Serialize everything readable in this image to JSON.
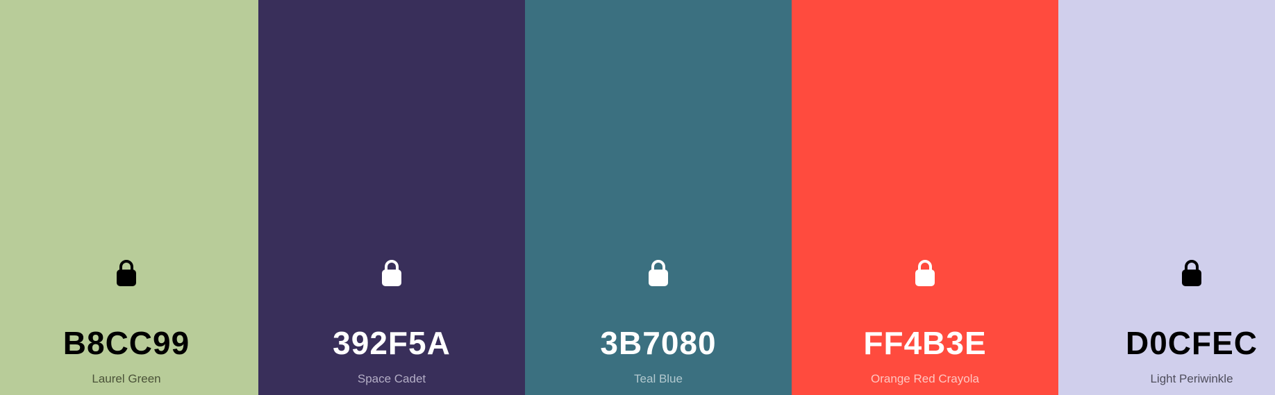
{
  "palette": {
    "swatches": [
      {
        "hex": "B8CC99",
        "name": "Laurel Green",
        "background": "#B8CC99",
        "text_color": "#000000",
        "name_color": "#4a5238",
        "lock_color": "#000000",
        "icon": "lock-icon"
      },
      {
        "hex": "392F5A",
        "name": "Space Cadet",
        "background": "#392F5A",
        "text_color": "#ffffff",
        "name_color": "#b4aec6",
        "lock_color": "#ffffff",
        "icon": "lock-icon"
      },
      {
        "hex": "3B7080",
        "name": "Teal Blue",
        "background": "#3B7080",
        "text_color": "#ffffff",
        "name_color": "#b3c9cf",
        "lock_color": "#ffffff",
        "icon": "lock-icon"
      },
      {
        "hex": "FF4B3E",
        "name": "Orange Red Crayola",
        "background": "#FF4B3E",
        "text_color": "#ffffff",
        "name_color": "#ffc6c1",
        "lock_color": "#ffffff",
        "icon": "lock-icon"
      },
      {
        "hex": "D0CFEC",
        "name": "Light Periwinkle",
        "background": "#D0CFEC",
        "text_color": "#000000",
        "name_color": "#4f4e5c",
        "lock_color": "#000000",
        "icon": "lock-icon"
      }
    ]
  }
}
